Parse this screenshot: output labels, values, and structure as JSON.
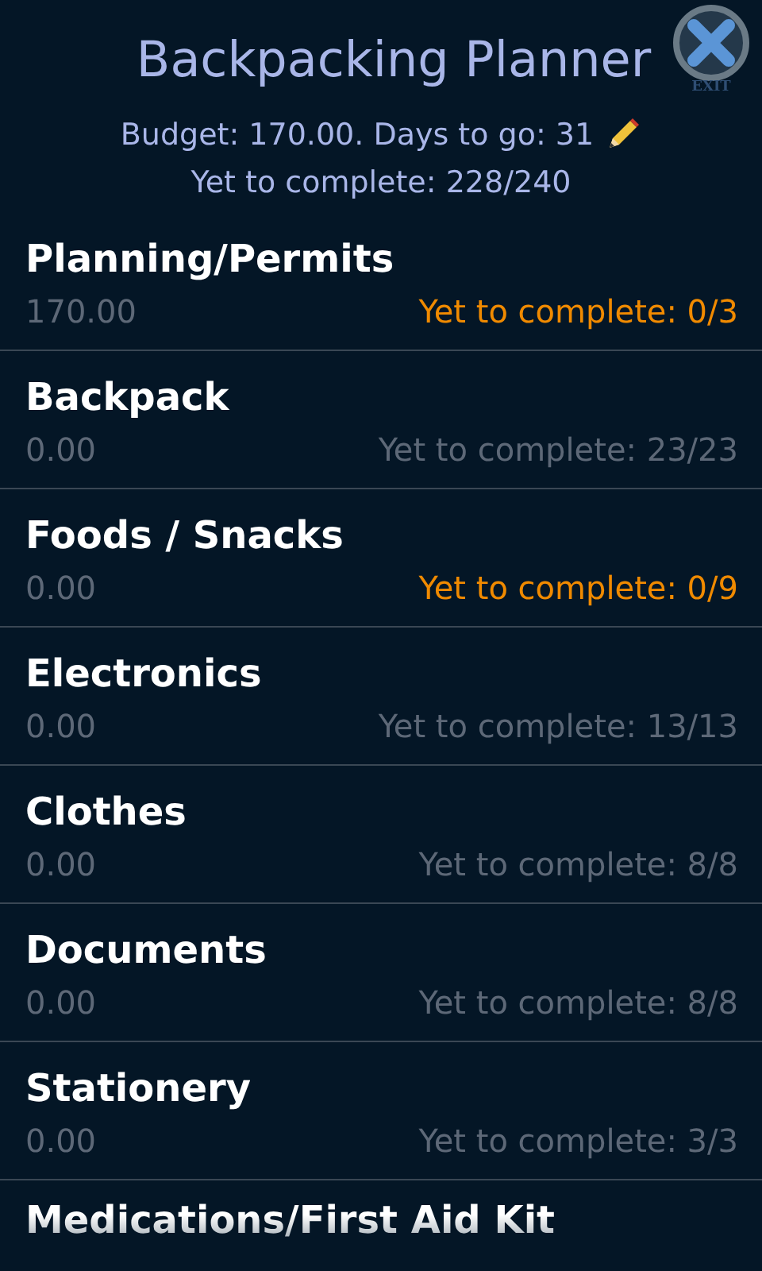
{
  "header": {
    "title": "Backpacking Planner",
    "exit_label": "EXIT",
    "summary": "Budget: 170.00. Days to go: 31",
    "progress": "Yet to complete: 228/240"
  },
  "categories": [
    {
      "name": "Planning/Permits",
      "amount": "170.00",
      "status": "Yet to complete: 0/3",
      "complete": true
    },
    {
      "name": "Backpack",
      "amount": "0.00",
      "status": "Yet to complete: 23/23",
      "complete": false
    },
    {
      "name": "Foods / Snacks",
      "amount": "0.00",
      "status": "Yet to complete: 0/9",
      "complete": true
    },
    {
      "name": "Electronics",
      "amount": "0.00",
      "status": "Yet to complete: 13/13",
      "complete": false
    },
    {
      "name": "Clothes",
      "amount": "0.00",
      "status": "Yet to complete: 8/8",
      "complete": false
    },
    {
      "name": "Documents",
      "amount": "0.00",
      "status": "Yet to complete: 8/8",
      "complete": false
    },
    {
      "name": "Stationery",
      "amount": "0.00",
      "status": "Yet to complete: 3/3",
      "complete": false
    },
    {
      "name": "Medications/First Aid Kit"
    }
  ]
}
